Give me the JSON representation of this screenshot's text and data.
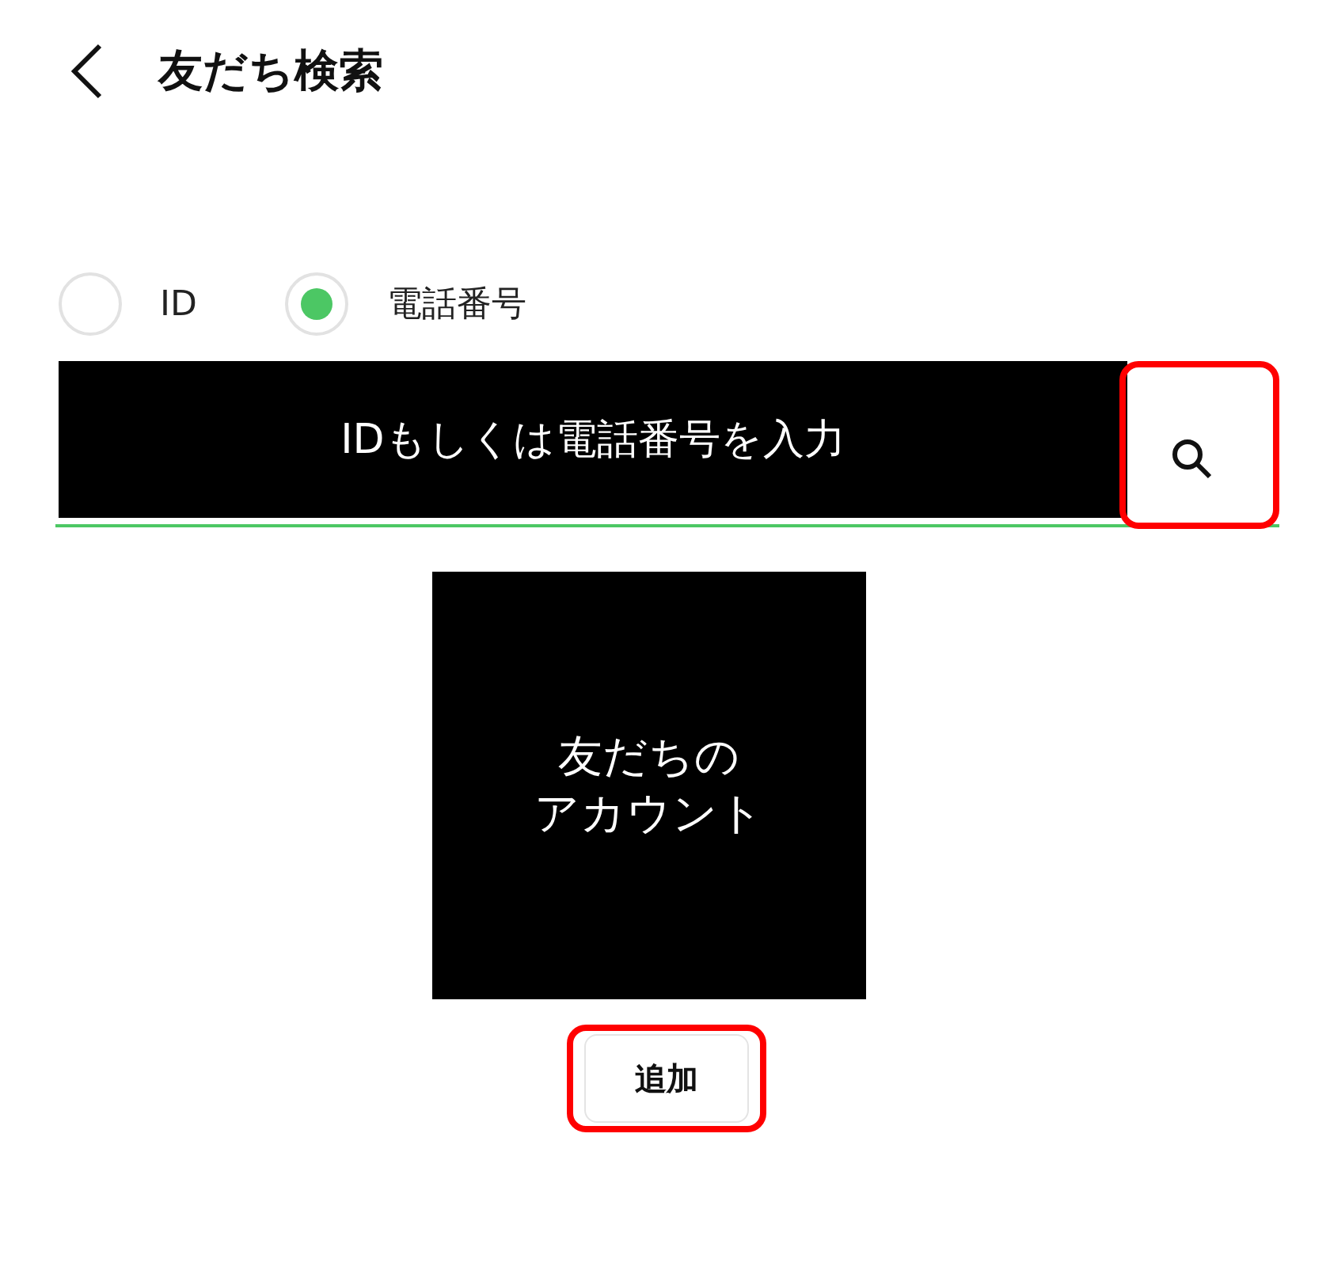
{
  "header": {
    "title": "友だち検索"
  },
  "search_types": [
    {
      "label": "ID",
      "selected": false
    },
    {
      "label": "電話番号",
      "selected": true
    }
  ],
  "search": {
    "cover_label": "IDもしくは電話番号を入力",
    "button_highlighted": true
  },
  "account_card": {
    "lines": [
      "友だちの",
      "アカウント"
    ]
  },
  "add_button": {
    "label": "追加",
    "highlighted": true
  }
}
